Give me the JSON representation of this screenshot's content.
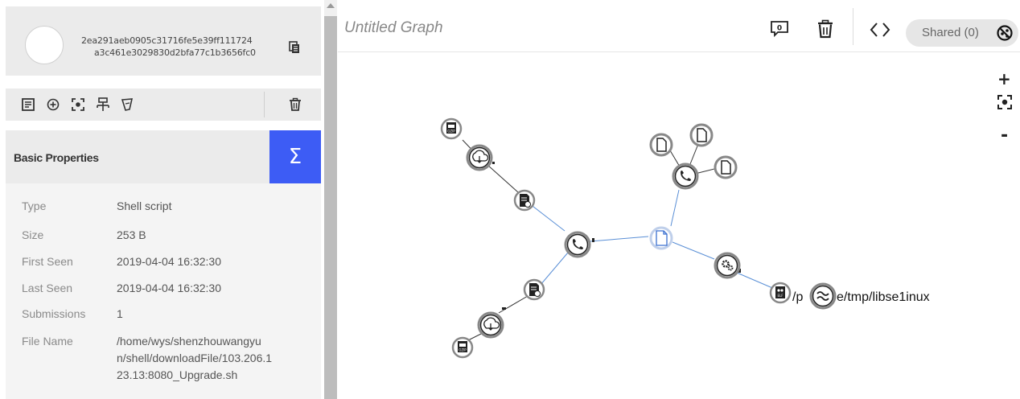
{
  "file": {
    "hash_line1": "2ea291aeb0905c31716fe5e39ff111724",
    "hash_line2": "a3c461e3029830d2bfa77c1b3656fc0"
  },
  "panel": {
    "title": "Basic Properties",
    "sigma": "Σ"
  },
  "properties": [
    {
      "key": "Type",
      "value": "Shell script"
    },
    {
      "key": "Size",
      "value": "253 B"
    },
    {
      "key": "First Seen",
      "value": "2019-04-04 16:32:30"
    },
    {
      "key": "Last Seen",
      "value": "2019-04-04 16:32:30"
    },
    {
      "key": "Submissions",
      "value": "1"
    },
    {
      "key": "File Name",
      "value": "/home/wys/shenzhouwangyun/shell/downloadFile/103.206.123.13:8080_Upgrade.sh",
      "value_lines": [
        "/home/wys/shenzhouwangyu",
        "n/shell/downloadFile/103.206.1",
        "23.13:8080_Upgrade.sh"
      ]
    }
  ],
  "graph": {
    "title": "Untitled Graph",
    "comment_count": "0",
    "shared_label": "Shared (0)",
    "zoom_in": "+",
    "zoom_out": "-",
    "node_label_tail": "/p",
    "node_label": "e/tmp/libse1inux"
  },
  "colors": {
    "accent": "#3d5cf5",
    "panel_bg": "#ebebeb",
    "edge_blue": "#5a8fd6",
    "edge_dark": "#333333"
  },
  "icons": [
    "copy-icon",
    "notes-icon",
    "add-circle-icon",
    "focus-icon",
    "tree-icon",
    "tag-icon",
    "trash-icon",
    "comment-icon",
    "code-icon",
    "no-share-icon"
  ]
}
